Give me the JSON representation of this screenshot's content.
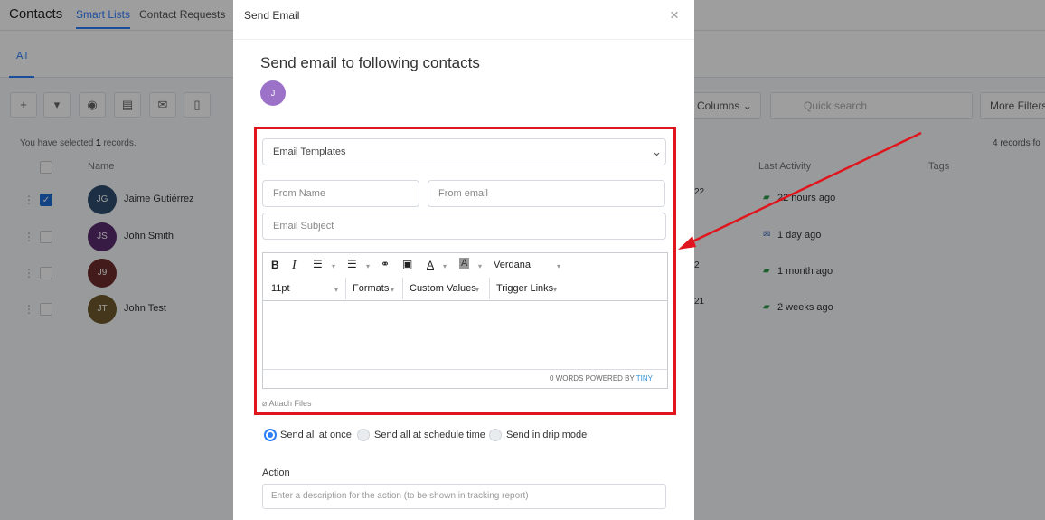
{
  "background": {
    "app_title": "Contacts",
    "top_tabs": [
      "Smart Lists",
      "Contact Requests"
    ],
    "sub_tab": "All",
    "toolbar_icons": [
      "plus-icon",
      "filter-icon",
      "robot-icon",
      "message-icon",
      "mail-icon",
      "clipboard-icon"
    ],
    "columns_label": "Columns",
    "search_placeholder": "Quick search",
    "more_filters_label": "More Filters",
    "selected_prefix": "You have selected ",
    "selected_count": "1",
    "selected_suffix": " records.",
    "records_found": "4 records fo",
    "headers": {
      "name": "Name",
      "last_activity": "Last Activity",
      "tags": "Tags"
    },
    "rows": [
      {
        "initials": "JG",
        "name": "Jaime Gutiérrez",
        "date": "22",
        "activity": "22 hours ago",
        "checked": true,
        "color": "#2e4c6e"
      },
      {
        "initials": "JS",
        "name": "John Smith",
        "date": "",
        "activity": "1 day ago",
        "checked": false,
        "color": "#5a2d6e"
      },
      {
        "initials": "J9",
        "name": "",
        "date": "2",
        "activity": "1 month ago",
        "checked": false,
        "color": "#6e2d2d"
      },
      {
        "initials": "JT",
        "name": "John Test",
        "date": "21",
        "activity": "2 weeks ago",
        "checked": false,
        "color": "#6e5a2d"
      }
    ]
  },
  "modal": {
    "title": "Send Email",
    "close_symbol": "×",
    "heading": "Send email to following contacts",
    "contact_initial": "J",
    "template_select": "Email Templates",
    "from_name_placeholder": "From Name",
    "from_email_placeholder": "From email",
    "subject_placeholder": "Email Subject",
    "editor": {
      "font_name": "Verdana",
      "font_size": "11pt",
      "formats": "Formats",
      "custom_values": "Custom Values",
      "trigger_links": "Trigger Links",
      "word_count": "0 WORDS POWERED BY ",
      "powered_brand": "TINY"
    },
    "attach_label": "Attach Files",
    "send_options": [
      "Send all at once",
      "Send all at schedule time",
      "Send in drip mode"
    ],
    "selected_send_option": 0,
    "action_label": "Action",
    "action_placeholder": "Enter a description for the action (to be shown in tracking report)"
  },
  "colors": {
    "accent": "#2d7ff9",
    "highlight": "#e0161e",
    "avatar": "#9b72c7"
  }
}
